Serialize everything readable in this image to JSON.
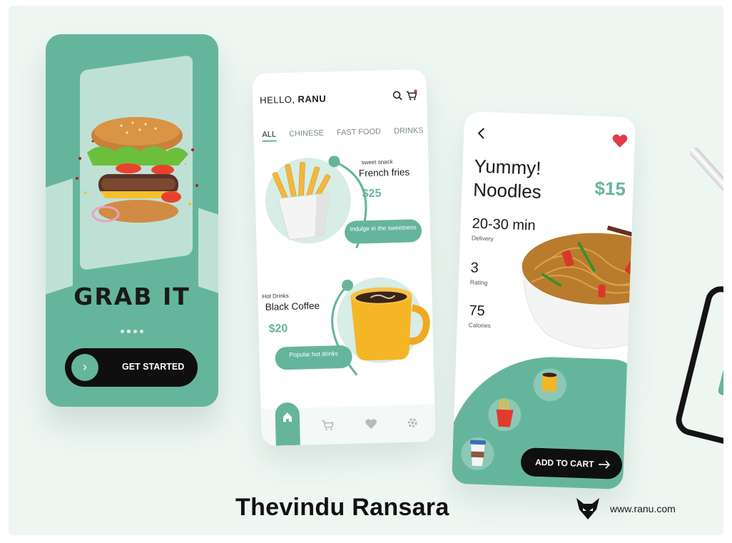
{
  "colors": {
    "accent": "#65b59c",
    "accent_light": "#bfe1d5",
    "background": "#eef6f2",
    "dark": "#0f0f0f",
    "heart": "#e23a4e"
  },
  "onboarding": {
    "headline": "GRAB IT",
    "pager_dots": 4,
    "active_dot": 2,
    "start_button": {
      "label": "GET STARTED",
      "icon": "chevron-right-icon"
    }
  },
  "menu": {
    "greeting_prefix": "HELLO,",
    "greeting_name": "RANU",
    "header_icons": [
      "search-icon",
      "cart-icon"
    ],
    "tabs": [
      {
        "label": "ALL",
        "active": true
      },
      {
        "label": "CHINESE",
        "active": false
      },
      {
        "label": "FAST FOOD",
        "active": false
      },
      {
        "label": "DRINKS",
        "active": false
      }
    ],
    "items": [
      {
        "tag": "sweet snack",
        "name": "French fries",
        "price": "$25",
        "pill": "Indulge in the sweetness"
      },
      {
        "tag": "Hot Drinks",
        "name": "Black Coffee",
        "price": "$20",
        "pill": "Popular hot drinks"
      }
    ],
    "nav": [
      "home-icon",
      "cart-icon",
      "heart-icon",
      "gear-icon"
    ]
  },
  "details": {
    "title_line1": "Yummy!",
    "title_line2": "Noodles",
    "price": "$15",
    "stats": [
      {
        "value": "20-30 min",
        "label": "Delivery"
      },
      {
        "value": "3",
        "label": "Rating"
      },
      {
        "value": "75",
        "label": "Calories"
      }
    ],
    "add_to_cart": "ADD TO CART"
  },
  "footer": {
    "author": "Thevindu Ransara",
    "website": "www.ranu.com"
  }
}
